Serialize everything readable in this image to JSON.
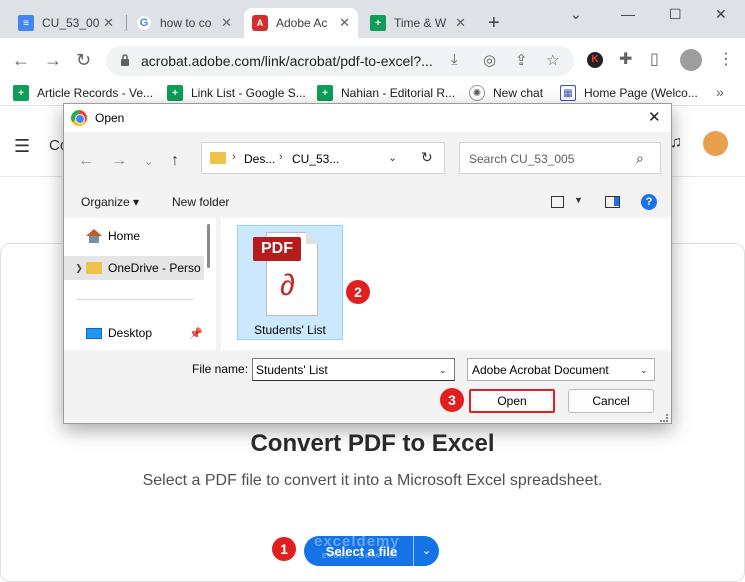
{
  "browser": {
    "tabs": [
      {
        "title": "CU_53_00",
        "icon": "google-docs-icon"
      },
      {
        "title": "how to co",
        "icon": "google-icon"
      },
      {
        "title": "Adobe Ac",
        "icon": "adobe-acrobat-icon",
        "active": true
      },
      {
        "title": "Time & W",
        "icon": "google-sheets-icon"
      }
    ],
    "url": "acrobat.adobe.com/link/acrobat/pdf-to-excel?...",
    "bookmarks": [
      {
        "label": "Article Records - Ve...",
        "icon": "google-sheets-icon"
      },
      {
        "label": "Link List - Google S...",
        "icon": "google-sheets-icon"
      },
      {
        "label": "Nahian - Editorial R...",
        "icon": "google-sheets-icon"
      },
      {
        "label": "New chat",
        "icon": "chatgpt-icon"
      },
      {
        "label": "Home Page (Welco...",
        "icon": "grid-icon"
      }
    ],
    "extension_badge": "K"
  },
  "page": {
    "header_partial": "Co",
    "title": "Convert PDF to Excel",
    "subtitle": "Select a PDF file to convert it into a Microsoft Excel spreadsheet.",
    "select_button": "Select a file",
    "watermark": "exceldemy",
    "watermark_sub": "EXCEL · DATA · BI"
  },
  "dialog": {
    "title": "Open",
    "path": [
      "Des...",
      "CU_53..."
    ],
    "search_placeholder": "Search CU_53_005",
    "organize_label": "Organize",
    "new_folder_label": "New folder",
    "nav_items": [
      {
        "label": "Home",
        "icon": "home-icon"
      },
      {
        "label": "OneDrive - Perso",
        "icon": "onedrive-folder-icon"
      },
      {
        "label": "Desktop",
        "icon": "desktop-icon"
      }
    ],
    "files": [
      {
        "name": "Students' List",
        "type_badge": "PDF"
      }
    ],
    "file_name_label": "File name:",
    "file_name_value": "Students' List",
    "file_type_value": "Adobe Acrobat Document",
    "open_label": "Open",
    "cancel_label": "Cancel"
  },
  "steps": [
    "1",
    "2",
    "3"
  ],
  "colors": {
    "accent": "#1473e6",
    "step_marker": "#e02020",
    "selection": "#cce8ff"
  }
}
